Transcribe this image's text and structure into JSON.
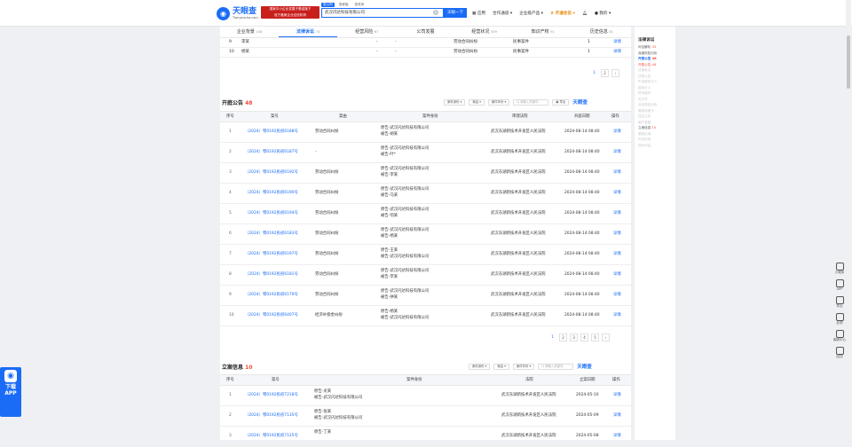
{
  "header": {
    "logo_cn": "天眼查",
    "logo_en": "Tianyancha.com",
    "ad_line1": "国家中小企业发展子基金旗下",
    "ad_line2": "官方备案企业征信机构",
    "search_tabs": [
      "查公司",
      "查老板",
      "查关系"
    ],
    "search_value": "武汉闪达科技有限公司",
    "search_button": "天眼一下",
    "nav": [
      "应用",
      "合作通道",
      "企业级产品",
      "开通会员",
      "我的"
    ]
  },
  "tabs": [
    {
      "label": "企业背景",
      "count": "108"
    },
    {
      "label": "法律诉讼",
      "count": "74"
    },
    {
      "label": "经营风险",
      "count": "67"
    },
    {
      "label": "公司发展",
      "count": ""
    },
    {
      "label": "经营状况",
      "count": "309"
    },
    {
      "label": "知识产权",
      "count": "91"
    },
    {
      "label": "历史信息",
      "count": "81"
    }
  ],
  "prev_table": {
    "rows": [
      {
        "no": "9",
        "party": "李某",
        "d1": "-",
        "d2": "-",
        "cause": "劳动合同纠纷",
        "type": "民事案件",
        "cnt": "1",
        "op": "详情"
      },
      {
        "no": "10",
        "party": "杨某",
        "d1": "-",
        "d2": "-",
        "cause": "劳动合同纠纷",
        "type": "民事案件",
        "cnt": "1",
        "op": "详情"
      }
    ],
    "pages": [
      "1",
      "2",
      "›"
    ]
  },
  "hearing": {
    "title": "开庭公告",
    "count": "48",
    "filters": [
      "案件身份 ▾",
      "案由 ▾",
      "案件年份 ▾"
    ],
    "search_placeholder": "Q 请输入关键词",
    "export": "导出",
    "brand": "天眼查",
    "headers": [
      "序号",
      "案号",
      "案由",
      "案件身份",
      "审理法院",
      "开庭日期",
      "操作"
    ],
    "rows": [
      {
        "no": "1",
        "case": "（2024）鄂0192民初6188号",
        "cause": "劳动合同纠纷",
        "p1": "原告-武汉闪达科技有限公司",
        "p2": "被告-胡某",
        "court": "武汉东湖新技术开发区人民法院",
        "date": "2024-08-14 08:40",
        "op": "详情"
      },
      {
        "no": "2",
        "case": "（2024）鄂0192民初6187号",
        "cause": "-",
        "p1": "原告-武汉闪达科技有限公司",
        "p2": "被告-叶*",
        "court": "武汉东湖新技术开发区人民法院",
        "date": "2024-08-14 08:40",
        "op": "详情"
      },
      {
        "no": "3",
        "case": "（2024）鄂0192民初6192号",
        "cause": "劳动合同纠纷",
        "p1": "原告-武汉闪达科技有限公司",
        "p2": "被告-李某",
        "court": "武汉东湖新技术开发区人民法院",
        "date": "2024-08-14 08:40",
        "op": "详情"
      },
      {
        "no": "4",
        "case": "（2024）鄂0192民初6190号",
        "cause": "劳动合同纠纷",
        "p1": "原告-武汉闪达科技有限公司",
        "p2": "被告-马某",
        "court": "武汉东湖新技术开发区人民法院",
        "date": "2024-08-14 08:40",
        "op": "详情"
      },
      {
        "no": "5",
        "case": "（2024）鄂0192民初6194号",
        "cause": "劳动合同纠纷",
        "p1": "原告-武汉闪达科技有限公司",
        "p2": "被告-何某",
        "court": "武汉东湖新技术开发区人民法院",
        "date": "2024-08-14 08:40",
        "op": "详情"
      },
      {
        "no": "6",
        "case": "（2024）鄂0192民初6183号",
        "cause": "劳动合同纠纷",
        "p1": "原告-武汉闪达科技有限公司",
        "p2": "被告-杨某",
        "court": "武汉东湖新技术开发区人民法院",
        "date": "2024-08-14 08:40",
        "op": "详情"
      },
      {
        "no": "7",
        "case": "（2024）鄂0192民初6197号",
        "cause": "劳动合同纠纷",
        "p1": "原告-王某",
        "p2": "被告-武汉闪达科技有限公司",
        "court": "武汉东湖新技术开发区人民法院",
        "date": "2024-08-14 08:40",
        "op": "详情"
      },
      {
        "no": "8",
        "case": "（2024）鄂0192民初6181号",
        "cause": "劳动合同纠纷",
        "p1": "原告-武汉闪达科技有限公司",
        "p2": "被告-李某",
        "court": "武汉东湖新技术开发区人民法院",
        "date": "2024-08-14 08:40",
        "op": "详情"
      },
      {
        "no": "9",
        "case": "（2024）鄂0192民初6179号",
        "cause": "劳动合同纠纷",
        "p1": "原告-武汉闪达科技有限公司",
        "p2": "被告-钟某",
        "court": "武汉东湖新技术开发区人民法院",
        "date": "2024-08-14 08:40",
        "op": "详情"
      },
      {
        "no": "10",
        "case": "（2024）鄂0192民初6407号",
        "cause": "经济补偿金纠纷",
        "p1": "原告-杨某",
        "p2": "被告-武汉闪达科技有限公司",
        "court": "武汉东湖新技术开发区人民法院",
        "date": "2024-08-14 08:40",
        "op": "详情"
      }
    ],
    "pages": [
      "1",
      "2",
      "3",
      "4",
      "5",
      "›"
    ]
  },
  "filing": {
    "title": "立案信息",
    "count": "10",
    "filters": [
      "案件身份 ▾",
      "案由 ▾",
      "案件年份 ▾"
    ],
    "search_placeholder": "Q 请输入关键词",
    "brand": "天眼查",
    "headers": [
      "序号",
      "案号",
      "案件身份",
      "法院",
      "立案日期",
      "操作"
    ],
    "rows": [
      {
        "no": "1",
        "case": "（2024）鄂0192民初7218号",
        "p1": "原告-龙某",
        "p2": "被告-武汉闪达科技有限公司",
        "court": "武汉东湖新技术开发区人民法院",
        "date": "2024-05-10",
        "op": "详情"
      },
      {
        "no": "2",
        "case": "（2024）鄂0192民初7135号",
        "p1": "原告-张某",
        "p2": "被告-武汉闪达科技有限公司",
        "court": "武汉东湖新技术开发区人民法院",
        "date": "2024-05-09",
        "op": "详情"
      },
      {
        "no": "3",
        "case": "（2024）鄂0192民初7125号",
        "p1": "原告-丁某",
        "p2": "",
        "court": "武汉东湖新技术开发区人民法院",
        "date": "2024-05-08",
        "op": "详情"
      }
    ]
  },
  "sidebar": {
    "title": "法律诉讼",
    "items": [
      {
        "label": "司法解析",
        "count": "33",
        "state": "on"
      },
      {
        "label": "深度风险分析",
        "count": "",
        "state": "on"
      },
      {
        "label": "开庭公告",
        "count": "48",
        "state": "active"
      },
      {
        "label": "开庭公告",
        "count": "48",
        "state": "red"
      },
      {
        "label": "法律诉讼",
        "count": "",
        "state": "off"
      },
      {
        "label": "法院公告",
        "count": "",
        "state": "off"
      },
      {
        "label": "失信被执行人",
        "count": "",
        "state": "off"
      },
      {
        "label": "被执行人",
        "count": "",
        "state": "off"
      },
      {
        "label": "终本案件",
        "count": "",
        "state": "off"
      },
      {
        "label": "支付令",
        "count": "",
        "state": "off"
      },
      {
        "label": "诉讼风险分析",
        "count": "",
        "state": "off"
      },
      {
        "label": "限制消费令",
        "count": "",
        "state": "off"
      },
      {
        "label": "送达公告",
        "count": "",
        "state": "off"
      },
      {
        "label": "破产重整",
        "count": "",
        "state": "off"
      },
      {
        "label": "立案信息",
        "count": "10",
        "state": "on"
      },
      {
        "label": "限制出境",
        "count": "",
        "state": "off"
      },
      {
        "label": "司法拍卖",
        "count": "",
        "state": "off"
      },
      {
        "label": "询价评估",
        "count": "",
        "state": "off"
      }
    ]
  },
  "rightbar": [
    "小程序",
    "APP",
    "导出",
    "反馈",
    "客服中心",
    "回顶"
  ],
  "download": {
    "line1": "下载",
    "line2": "APP"
  }
}
